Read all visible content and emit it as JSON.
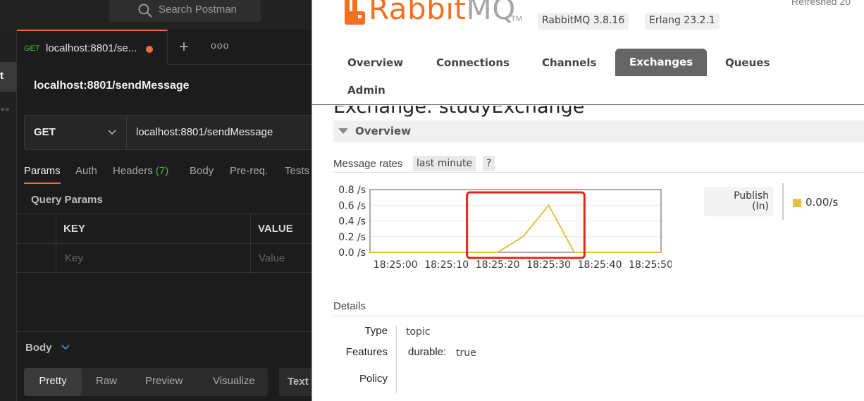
{
  "postman": {
    "search_placeholder": "Search Postman",
    "sidebar_letter": "t",
    "sidebar_more": "∘∘",
    "tab": {
      "method": "GET",
      "title": "localhost:8801/se..."
    },
    "tab_more": "ooo",
    "request_title": "localhost:8801/sendMessage",
    "method": "GET",
    "url": "localhost:8801/sendMessage",
    "subtabs": {
      "params": "Params",
      "auth": "Auth",
      "headers": "Headers",
      "headers_count": "(7)",
      "body": "Body",
      "prereq": "Pre-req.",
      "tests": "Tests"
    },
    "query_params_label": "Query Params",
    "table": {
      "key_header": "KEY",
      "value_header": "VALUE",
      "key_placeholder": "Key",
      "value_placeholder": "Value"
    },
    "body_label": "Body",
    "body_views": [
      "Pretty",
      "Raw",
      "Preview",
      "Visualize"
    ],
    "body_format": "Text",
    "colors": {
      "accent": "#f26b3a",
      "get_method": "#4caf50"
    }
  },
  "rabbitmq": {
    "logo_r": "Rabbit",
    "logo_mq": "MQ",
    "logo_tm": "TM",
    "version": "RabbitMQ 3.8.16",
    "erlang": "Erlang 23.2.1",
    "refreshed": "Refreshed 20",
    "nav": [
      "Overview",
      "Connections",
      "Channels",
      "Exchanges",
      "Queues",
      "Admin"
    ],
    "active_nav": "Exchanges",
    "page_title": "Exchange: studyExchange",
    "section_title": "Overview",
    "message_rates_label": "Message rates",
    "range": "last minute",
    "help": "?",
    "legend": {
      "series_line1": "Publish",
      "series_line2": "(In)",
      "value": "0.00/s",
      "color": "#e6c040"
    },
    "details_title": "Details",
    "details": {
      "type_label": "Type",
      "type_value": "topic",
      "features_label": "Features",
      "features_key": "durable:",
      "features_value": "true",
      "policy_label": "Policy"
    },
    "colors": {
      "brand": "#f36f21",
      "highlight_box": "#e3241b"
    }
  },
  "chart_data": {
    "type": "line",
    "title": "",
    "xlabel": "",
    "ylabel": "",
    "y_ticks": [
      "0.8 /s",
      "0.6 /s",
      "0.4 /s",
      "0.2 /s",
      "0.0 /s"
    ],
    "y_tick_values": [
      0.8,
      0.6,
      0.4,
      0.2,
      0.0
    ],
    "x_ticks": [
      "18:25:00",
      "18:25:10",
      "18:25:20",
      "18:25:30",
      "18:25:40",
      "18:25:50"
    ],
    "ylim": [
      0,
      0.8
    ],
    "xlim": [
      "18:24:55",
      "18:25:52"
    ],
    "grid": true,
    "series": [
      {
        "color": "#e6c040",
        "points": [
          [
            "18:24:55",
            0.0
          ],
          [
            "18:25:15",
            0.0
          ],
          [
            "18:25:20",
            0.0
          ],
          [
            "18:25:25",
            0.2
          ],
          [
            "18:25:30",
            0.6
          ],
          [
            "18:25:35",
            0.0
          ],
          [
            "18:25:40",
            0.0
          ],
          [
            "18:25:52",
            0.0
          ]
        ]
      }
    ],
    "highlight": {
      "from": "18:25:14",
      "to": "18:25:37"
    }
  }
}
